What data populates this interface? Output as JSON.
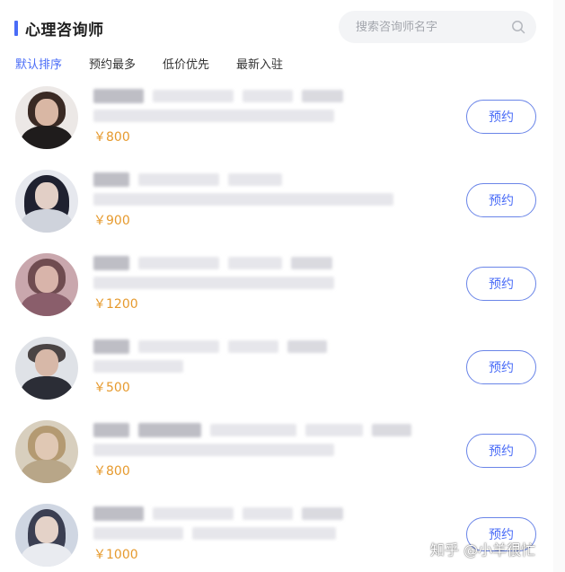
{
  "header": {
    "title": "心理咨询师",
    "search": {
      "placeholder": "搜索咨询师名字",
      "icon": "search-icon"
    }
  },
  "sort_tabs": [
    {
      "label": "默认排序",
      "active": true
    },
    {
      "label": "预约最多",
      "active": false
    },
    {
      "label": "低价优先",
      "active": false
    },
    {
      "label": "最新入驻",
      "active": false
    }
  ],
  "counselors": [
    {
      "price": "￥800",
      "button": "预约"
    },
    {
      "price": "￥900",
      "button": "预约"
    },
    {
      "price": "￥1200",
      "button": "预约"
    },
    {
      "price": "￥500",
      "button": "预约"
    },
    {
      "price": "￥800",
      "button": "预约"
    },
    {
      "price": "￥1000",
      "button": "预约"
    }
  ],
  "watermark": "知乎 @小羊很忙",
  "colors": {
    "accent": "#4a6cf7",
    "price": "#e69a2e",
    "search_bg": "#f3f4f6"
  }
}
